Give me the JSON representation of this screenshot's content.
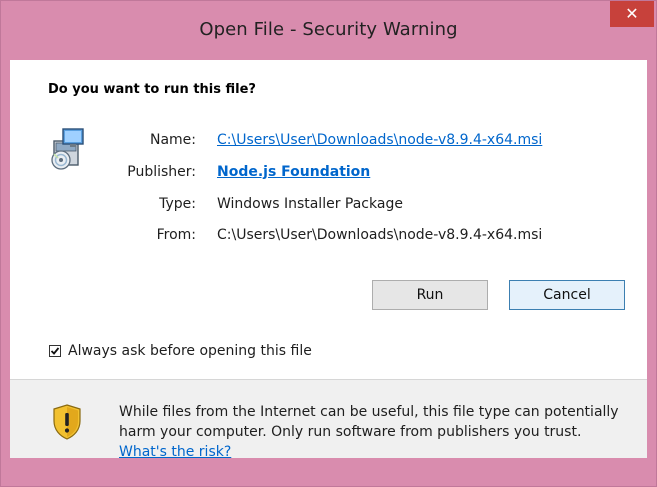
{
  "window": {
    "title": "Open File - Security Warning",
    "close_symbol": "✕",
    "frame_color": "#d98cae",
    "close_color": "#c7413b"
  },
  "dialog": {
    "question": "Do you want to run this file?",
    "icon": "installer-package-icon",
    "fields": {
      "name_label": "Name:",
      "name_value": "C:\\Users\\User\\Downloads\\node-v8.9.4-x64.msi",
      "publisher_label": "Publisher:",
      "publisher_value": "Node.js Foundation",
      "type_label": "Type:",
      "type_value": "Windows Installer Package",
      "from_label": "From:",
      "from_value": "C:\\Users\\User\\Downloads\\node-v8.9.4-x64.msi"
    },
    "buttons": {
      "run": "Run",
      "cancel": "Cancel"
    },
    "checkbox": {
      "label": "Always ask before opening this file",
      "checked": true
    },
    "warning": {
      "icon": "warning-shield-icon",
      "line1": "While files from the Internet can be useful, this file type can potentially",
      "line2": "harm your computer. Only run software from publishers you trust.",
      "link": "What's the risk?"
    },
    "link_color": "#0066cc"
  }
}
